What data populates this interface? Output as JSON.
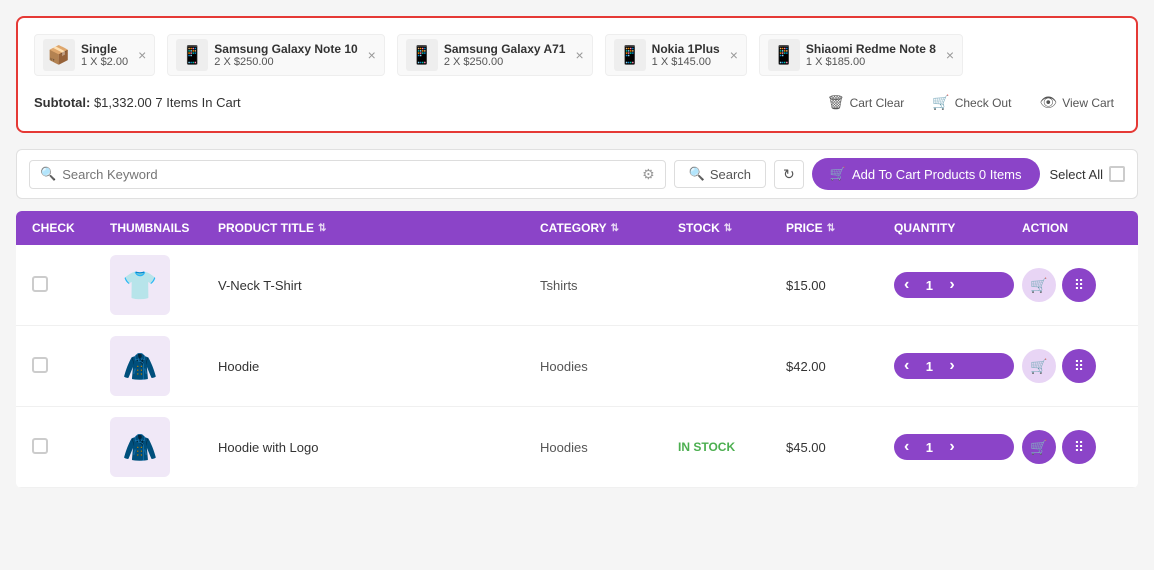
{
  "cart": {
    "items": [
      {
        "id": 1,
        "icon": "📦",
        "name": "Single",
        "qty": "1",
        "price": "$2.00"
      },
      {
        "id": 2,
        "icon": "📱",
        "name": "Samsung Galaxy Note 10",
        "qty": "2",
        "price": "$250.00"
      },
      {
        "id": 3,
        "icon": "📱",
        "name": "Samsung Galaxy A71",
        "qty": "2",
        "price": "$250.00"
      },
      {
        "id": 4,
        "icon": "📱",
        "name": "Nokia 1Plus",
        "qty": "1",
        "price": "$145.00"
      },
      {
        "id": 5,
        "icon": "📱",
        "name": "Shiaomi Redme Note 8",
        "qty": "1",
        "price": "$185.00"
      }
    ],
    "subtotal_label": "Subtotal:",
    "subtotal_value": "$1,332.00",
    "items_in_cart": "7 Items In Cart",
    "cart_clear_label": "Cart Clear",
    "checkout_label": "Check Out",
    "view_cart_label": "View Cart"
  },
  "search": {
    "placeholder": "Search Keyword",
    "search_btn_label": "Search",
    "add_to_cart_label": "Add To Cart Products 0 Items",
    "select_all_label": "Select All"
  },
  "table": {
    "headers": [
      {
        "key": "check",
        "label": "CHECK",
        "sortable": false
      },
      {
        "key": "thumbnails",
        "label": "THUMBNAILS",
        "sortable": false
      },
      {
        "key": "product_title",
        "label": "PRODUCT TITLE",
        "sortable": true
      },
      {
        "key": "category",
        "label": "CATEGORY",
        "sortable": true
      },
      {
        "key": "stock",
        "label": "STOCK",
        "sortable": true
      },
      {
        "key": "price",
        "label": "PRICE",
        "sortable": true
      },
      {
        "key": "quantity",
        "label": "QUANTITY",
        "sortable": false
      },
      {
        "key": "action",
        "label": "ACTION",
        "sortable": false
      }
    ],
    "rows": [
      {
        "id": 1,
        "icon": "👕",
        "title": "V-Neck T-Shirt",
        "category": "Tshirts",
        "stock": "",
        "stock_in": false,
        "price": "$15.00",
        "qty": 1
      },
      {
        "id": 2,
        "icon": "🧥",
        "title": "Hoodie",
        "category": "Hoodies",
        "stock": "",
        "stock_in": false,
        "price": "$42.00",
        "qty": 1
      },
      {
        "id": 3,
        "icon": "🧥",
        "title": "Hoodie with Logo",
        "category": "Hoodies",
        "stock": "IN STOCK",
        "stock_in": true,
        "price": "$45.00",
        "qty": 1
      }
    ]
  }
}
